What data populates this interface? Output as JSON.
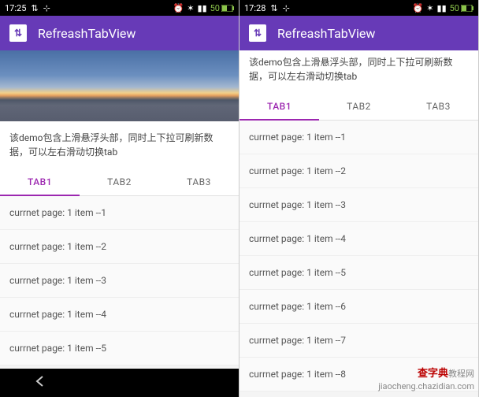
{
  "left": {
    "status": {
      "time": "17:25",
      "battery": "50"
    },
    "appTitle": "RefreashTabView",
    "desc": "该demo包含上滑悬浮头部，同时上下拉可刷新数据，可以左右滑动切换tab",
    "tabs": [
      "TAB1",
      "TAB2",
      "TAB3"
    ],
    "activeTab": 0,
    "items": [
      "currnet page: 1 item --1",
      "currnet page: 1 item --2",
      "currnet page: 1 item --3",
      "currnet page: 1 item --4",
      "currnet page: 1 item --5"
    ]
  },
  "right": {
    "status": {
      "time": "17:28",
      "battery": "50"
    },
    "appTitle": "RefreashTabView",
    "desc": "该demo包含上滑悬浮头部，同时上下拉可刷新数据，可以左右滑动切换tab",
    "tabs": [
      "TAB1",
      "TAB2",
      "TAB3"
    ],
    "activeTab": 0,
    "items": [
      "currnet page: 1 item --1",
      "currnet page: 1 item --2",
      "currnet page: 1 item --3",
      "currnet page: 1 item --4",
      "currnet page: 1 item --5",
      "currnet page: 1 item --6",
      "currnet page: 1 item --7",
      "currnet page: 1 item --8"
    ]
  },
  "watermark": {
    "brand": "查字典",
    "sub1": "教程网",
    "sub2": "jiaocheng.chazidian.com"
  }
}
